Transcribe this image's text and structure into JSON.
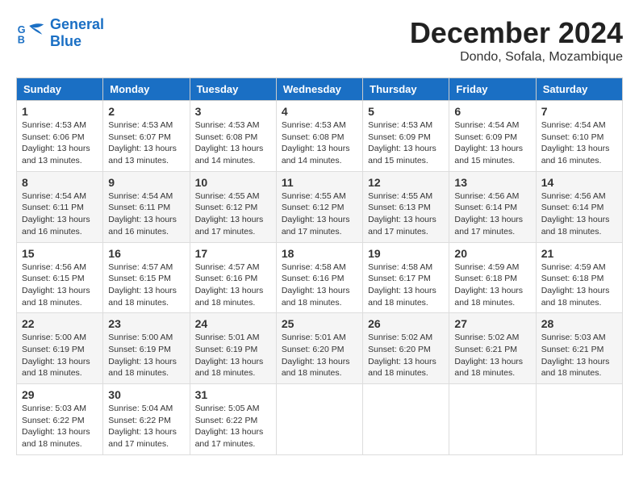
{
  "logo": {
    "line1": "General",
    "line2": "Blue"
  },
  "title": "December 2024",
  "location": "Dondo, Sofala, Mozambique",
  "days_of_week": [
    "Sunday",
    "Monday",
    "Tuesday",
    "Wednesday",
    "Thursday",
    "Friday",
    "Saturday"
  ],
  "weeks": [
    [
      {
        "day": "1",
        "sunrise": "4:53 AM",
        "sunset": "6:06 PM",
        "daylight": "13 hours and 13 minutes."
      },
      {
        "day": "2",
        "sunrise": "4:53 AM",
        "sunset": "6:07 PM",
        "daylight": "13 hours and 13 minutes."
      },
      {
        "day": "3",
        "sunrise": "4:53 AM",
        "sunset": "6:08 PM",
        "daylight": "13 hours and 14 minutes."
      },
      {
        "day": "4",
        "sunrise": "4:53 AM",
        "sunset": "6:08 PM",
        "daylight": "13 hours and 14 minutes."
      },
      {
        "day": "5",
        "sunrise": "4:53 AM",
        "sunset": "6:09 PM",
        "daylight": "13 hours and 15 minutes."
      },
      {
        "day": "6",
        "sunrise": "4:54 AM",
        "sunset": "6:09 PM",
        "daylight": "13 hours and 15 minutes."
      },
      {
        "day": "7",
        "sunrise": "4:54 AM",
        "sunset": "6:10 PM",
        "daylight": "13 hours and 16 minutes."
      }
    ],
    [
      {
        "day": "8",
        "sunrise": "4:54 AM",
        "sunset": "6:11 PM",
        "daylight": "13 hours and 16 minutes."
      },
      {
        "day": "9",
        "sunrise": "4:54 AM",
        "sunset": "6:11 PM",
        "daylight": "13 hours and 16 minutes."
      },
      {
        "day": "10",
        "sunrise": "4:55 AM",
        "sunset": "6:12 PM",
        "daylight": "13 hours and 17 minutes."
      },
      {
        "day": "11",
        "sunrise": "4:55 AM",
        "sunset": "6:12 PM",
        "daylight": "13 hours and 17 minutes."
      },
      {
        "day": "12",
        "sunrise": "4:55 AM",
        "sunset": "6:13 PM",
        "daylight": "13 hours and 17 minutes."
      },
      {
        "day": "13",
        "sunrise": "4:56 AM",
        "sunset": "6:14 PM",
        "daylight": "13 hours and 17 minutes."
      },
      {
        "day": "14",
        "sunrise": "4:56 AM",
        "sunset": "6:14 PM",
        "daylight": "13 hours and 18 minutes."
      }
    ],
    [
      {
        "day": "15",
        "sunrise": "4:56 AM",
        "sunset": "6:15 PM",
        "daylight": "13 hours and 18 minutes."
      },
      {
        "day": "16",
        "sunrise": "4:57 AM",
        "sunset": "6:15 PM",
        "daylight": "13 hours and 18 minutes."
      },
      {
        "day": "17",
        "sunrise": "4:57 AM",
        "sunset": "6:16 PM",
        "daylight": "13 hours and 18 minutes."
      },
      {
        "day": "18",
        "sunrise": "4:58 AM",
        "sunset": "6:16 PM",
        "daylight": "13 hours and 18 minutes."
      },
      {
        "day": "19",
        "sunrise": "4:58 AM",
        "sunset": "6:17 PM",
        "daylight": "13 hours and 18 minutes."
      },
      {
        "day": "20",
        "sunrise": "4:59 AM",
        "sunset": "6:18 PM",
        "daylight": "13 hours and 18 minutes."
      },
      {
        "day": "21",
        "sunrise": "4:59 AM",
        "sunset": "6:18 PM",
        "daylight": "13 hours and 18 minutes."
      }
    ],
    [
      {
        "day": "22",
        "sunrise": "5:00 AM",
        "sunset": "6:19 PM",
        "daylight": "13 hours and 18 minutes."
      },
      {
        "day": "23",
        "sunrise": "5:00 AM",
        "sunset": "6:19 PM",
        "daylight": "13 hours and 18 minutes."
      },
      {
        "day": "24",
        "sunrise": "5:01 AM",
        "sunset": "6:19 PM",
        "daylight": "13 hours and 18 minutes."
      },
      {
        "day": "25",
        "sunrise": "5:01 AM",
        "sunset": "6:20 PM",
        "daylight": "13 hours and 18 minutes."
      },
      {
        "day": "26",
        "sunrise": "5:02 AM",
        "sunset": "6:20 PM",
        "daylight": "13 hours and 18 minutes."
      },
      {
        "day": "27",
        "sunrise": "5:02 AM",
        "sunset": "6:21 PM",
        "daylight": "13 hours and 18 minutes."
      },
      {
        "day": "28",
        "sunrise": "5:03 AM",
        "sunset": "6:21 PM",
        "daylight": "13 hours and 18 minutes."
      }
    ],
    [
      {
        "day": "29",
        "sunrise": "5:03 AM",
        "sunset": "6:22 PM",
        "daylight": "13 hours and 18 minutes."
      },
      {
        "day": "30",
        "sunrise": "5:04 AM",
        "sunset": "6:22 PM",
        "daylight": "13 hours and 17 minutes."
      },
      {
        "day": "31",
        "sunrise": "5:05 AM",
        "sunset": "6:22 PM",
        "daylight": "13 hours and 17 minutes."
      },
      null,
      null,
      null,
      null
    ]
  ]
}
